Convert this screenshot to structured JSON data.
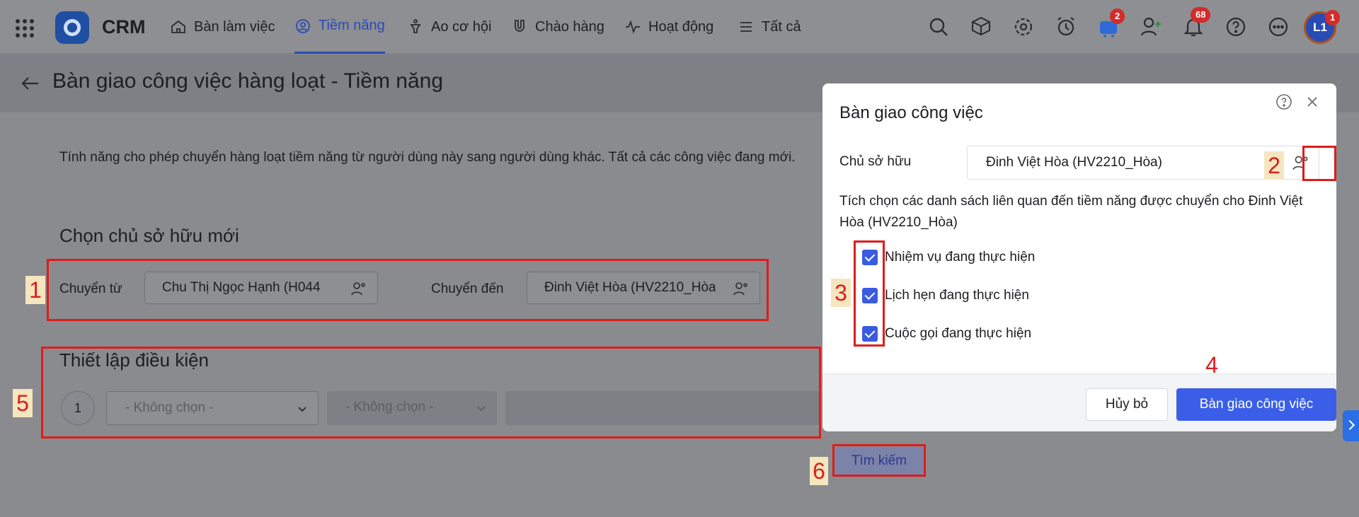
{
  "app": {
    "brand": "CRM"
  },
  "nav": {
    "items": [
      {
        "label": "Bàn làm việc",
        "icon": "home-icon"
      },
      {
        "label": "Tiềm năng",
        "icon": "user-circle-icon",
        "active": true
      },
      {
        "label": "Ao cơ hội",
        "icon": "funnel-icon"
      },
      {
        "label": "Chào hàng",
        "icon": "magnet-icon"
      },
      {
        "label": "Hoạt động",
        "icon": "pulse-icon"
      },
      {
        "label": "Tất cả",
        "icon": "menu-icon"
      }
    ]
  },
  "top_icons": {
    "cart_badge": "2",
    "notifications_badge": "68",
    "avatar_initials": "L1",
    "avatar_badge": "1"
  },
  "page": {
    "title": "Bàn giao công việc hàng loạt - Tiềm năng",
    "description": "Tính năng cho phép chuyển hàng loạt tiềm năng từ người dùng này sang người dùng khác. Tất cả các công việc đang mới.",
    "owner_section_title": "Chọn chủ sở hữu mới",
    "from_label": "Chuyển từ",
    "from_value": "Chu Thị Ngọc Hạnh (H044",
    "to_label": "Chuyển đến",
    "to_value": "Đinh Việt Hòa (HV2210_Hòa)",
    "condition_section_title": "Thiết lập điều kiện",
    "condition_index": "1",
    "condition_select_1": "- Không chọn -",
    "condition_select_2": "- Không chọn -",
    "search_button": "Tìm kiếm"
  },
  "dialog": {
    "title": "Bàn giao công việc",
    "owner_label": "Chủ sở hữu",
    "owner_value": "Đinh Việt Hòa (HV2210_Hòa)",
    "note": "Tích chọn các danh sách liên quan đến tiềm năng được chuyển cho Đinh Việt Hòa (HV2210_Hòa)",
    "options": [
      {
        "label": "Nhiệm vụ đang thực hiện",
        "checked": true
      },
      {
        "label": "Lịch hẹn đang thực hiện",
        "checked": true
      },
      {
        "label": "Cuộc gọi đang thực hiện",
        "checked": true
      }
    ],
    "cancel_button": "Hủy bỏ",
    "submit_button": "Bàn giao công việc"
  },
  "annotations": [
    "1",
    "2",
    "3",
    "4",
    "5",
    "6"
  ],
  "colors": {
    "accent": "#3b5ee8",
    "highlight": "#e01b1b",
    "badge": "#d42b2b",
    "overlay": "#8a8b8f"
  }
}
